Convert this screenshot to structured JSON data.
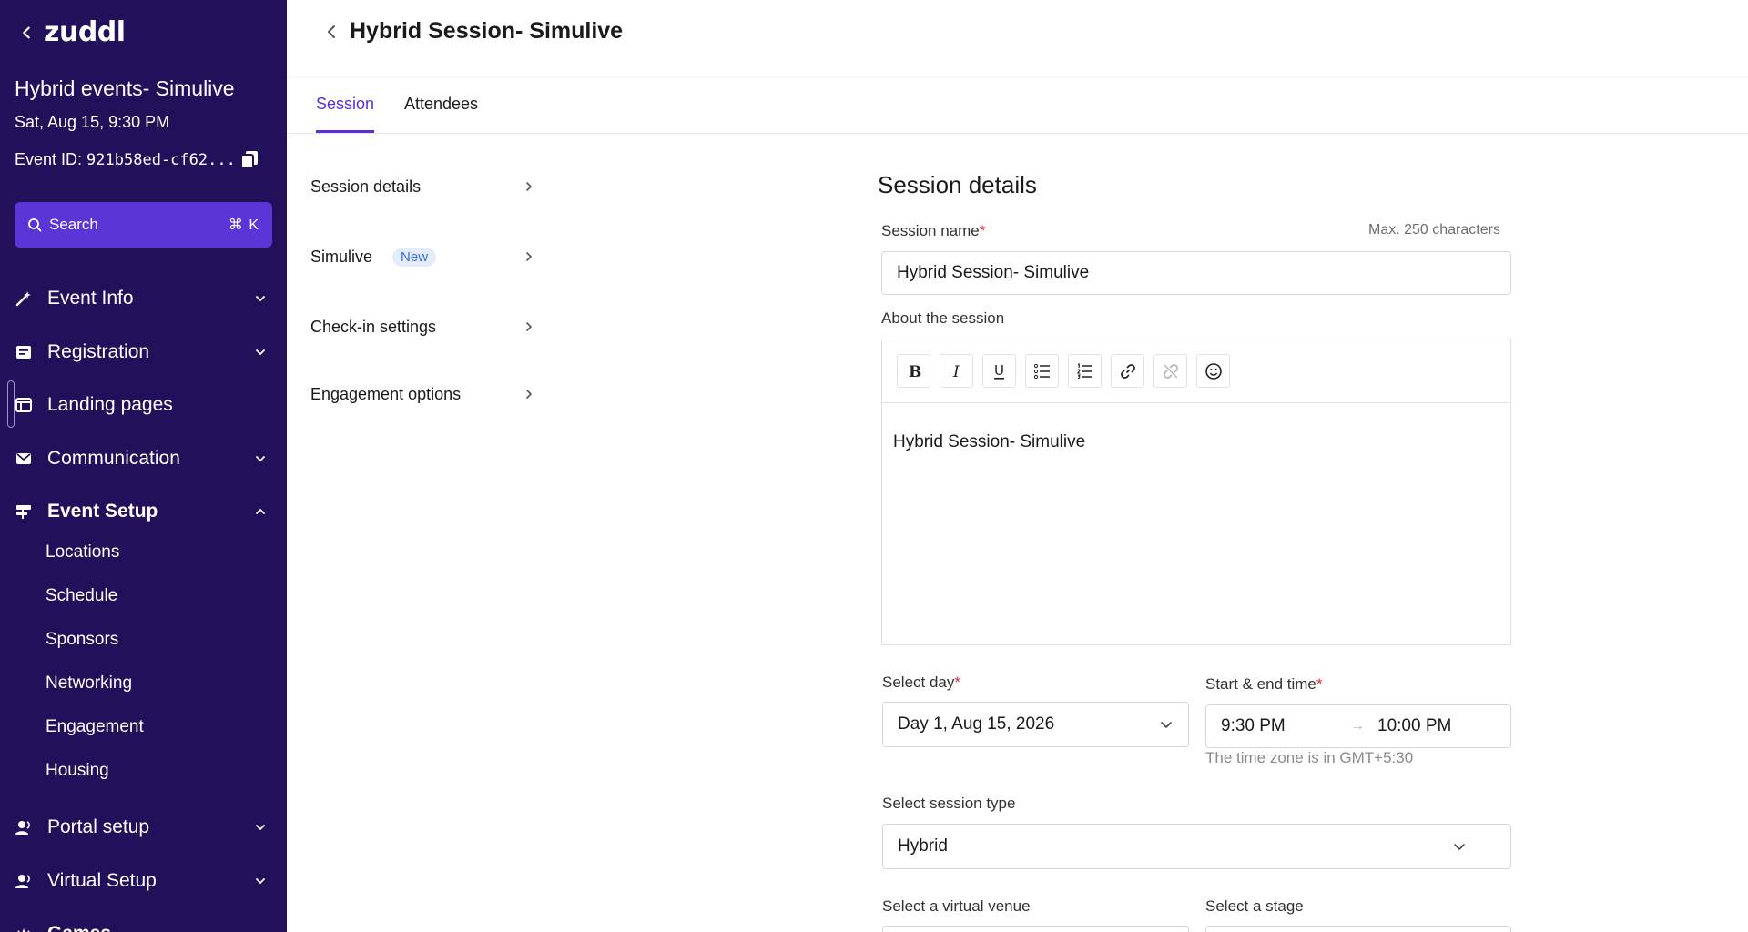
{
  "sidebar": {
    "logo": "zuddl",
    "event_title": "Hybrid events- Simulive",
    "event_date": "Sat, Aug 15, 9:30 PM",
    "event_id_label": "Event ID:",
    "event_id_value": "921b58ed-cf62...",
    "search_label": "Search",
    "search_shortcut": "⌘ K",
    "items": [
      {
        "label": "Event Info",
        "icon": "wand-icon"
      },
      {
        "label": "Registration",
        "icon": "form-icon"
      },
      {
        "label": "Landing pages",
        "icon": "browser-icon"
      },
      {
        "label": "Communication",
        "icon": "mail-icon"
      },
      {
        "label": "Event Setup",
        "icon": "signpost-icon"
      },
      {
        "label": "Portal setup",
        "icon": "person-icon"
      },
      {
        "label": "Virtual Setup",
        "icon": "person-icon"
      },
      {
        "label": "Games",
        "icon": "games-icon"
      }
    ],
    "event_setup_sub": [
      "Locations",
      "Schedule",
      "Sponsors",
      "Networking",
      "Engagement",
      "Housing"
    ]
  },
  "header": {
    "title": "Hybrid Session- Simulive"
  },
  "tabs": [
    "Session",
    "Attendees"
  ],
  "submenu": {
    "items": [
      "Session details",
      "Simulive",
      "Check-in settings",
      "Engagement options"
    ],
    "new_badge": "New"
  },
  "form": {
    "title": "Session details",
    "session_name_label": "Session name",
    "required_mark": "*",
    "max_chars_hint": "Max. 250 characters",
    "session_name_value": "Hybrid Session- Simulive",
    "about_label": "About the session",
    "about_value": "Hybrid Session- Simulive",
    "select_day_label": "Select day",
    "select_day_value": "Day 1, Aug 15, 2026",
    "time_label": "Start & end time",
    "start_time": "9:30 PM",
    "end_time": "10:00 PM",
    "time_arrow": "→",
    "timezone_note": "The time zone is in GMT+5:30",
    "session_type_label": "Select session type",
    "session_type_value": "Hybrid",
    "virtual_venue_label": "Select a virtual venue",
    "stage_label": "Select a stage"
  },
  "colors": {
    "sidebar_bg": "#22105a",
    "accent": "#5b2ed9",
    "search_bg": "#5b35d5",
    "required": "#e0263a"
  }
}
